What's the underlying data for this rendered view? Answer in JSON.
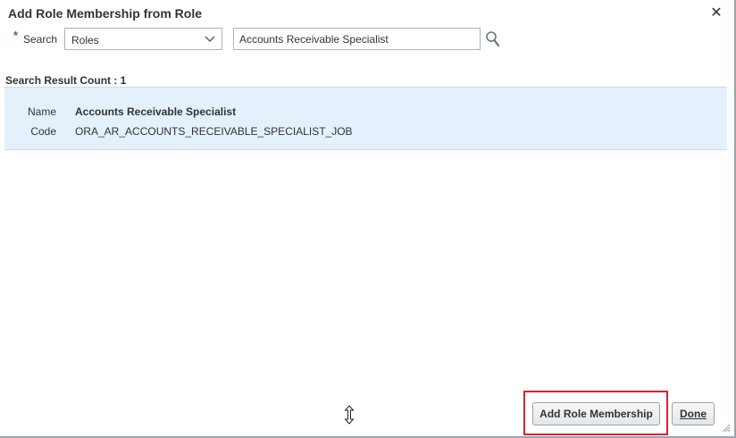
{
  "dialog": {
    "title": "Add Role Membership from Role",
    "close_label": "✕"
  },
  "search": {
    "required_mark": "*",
    "label": "Search",
    "type_selected": "Roles",
    "query_value": "Accounts Receivable Specialist"
  },
  "results": {
    "count_label": "Search Result Count : 1",
    "rows": [
      {
        "name_label": "Name",
        "name_value": "Accounts Receivable Specialist",
        "code_label": "Code",
        "code_value": "ORA_AR_ACCOUNTS_RECEIVABLE_SPECIALIST_JOB"
      }
    ]
  },
  "footer": {
    "add_button_label": "Add Role Membership",
    "done_button_label": "Done"
  },
  "colors": {
    "accent": "#2a6ebb",
    "row_selected": "#e4f0fb",
    "highlight": "#d9232d"
  },
  "icons": [
    "close-icon",
    "chevron-down-icon",
    "search-icon",
    "resize-cursor-icon",
    "resize-grip-icon"
  ]
}
